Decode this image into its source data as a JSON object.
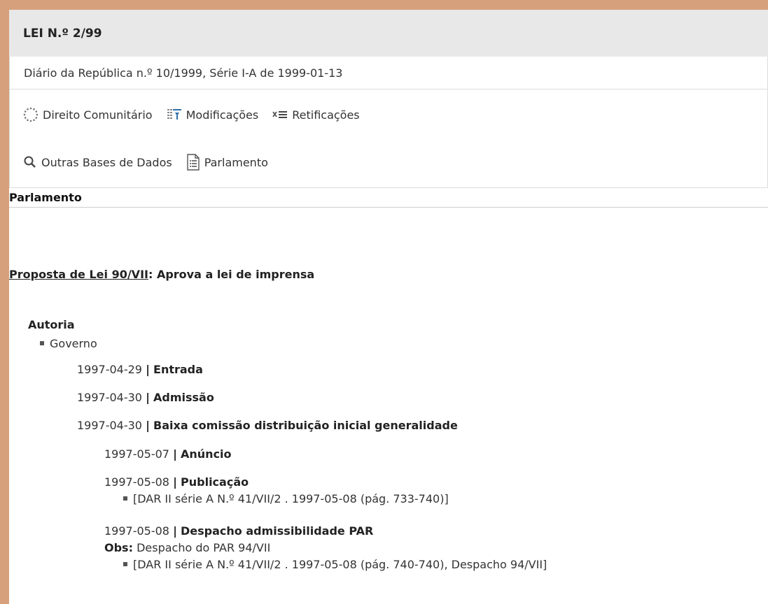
{
  "header": {
    "title": "LEI N.º 2/99"
  },
  "subinfo": {
    "text": "Diário da República n.º 10/1999, Série I-A de 1999-01-13"
  },
  "toolbar": {
    "direito": "Direito Comunitário",
    "modificacoes": "Modificações",
    "retificacoes": "Retificações",
    "outras": "Outras Bases de Dados",
    "parlamento": "Parlamento"
  },
  "section": {
    "title": "Parlamento"
  },
  "proposta": {
    "link": "Proposta de Lei 90/VII",
    "rest": ": Aprova a lei de imprensa"
  },
  "autoria": {
    "label": "Autoria",
    "item": "Governo"
  },
  "events": [
    {
      "date": "1997-04-29",
      "label": "Entrada"
    },
    {
      "date": "1997-04-30",
      "label": "Admissão"
    },
    {
      "date": "1997-04-30",
      "label": "Baixa comissão distribuição inicial generalidade"
    },
    {
      "date": "1997-05-07",
      "label": "Anúncio"
    },
    {
      "date": "1997-05-08",
      "label": "Publicação",
      "ref": "[DAR II série A N.º 41/VII/2 . 1997-05-08 (pág. 733-740)]"
    },
    {
      "date": "1997-05-08",
      "label": "Despacho admissibilidade PAR",
      "obs_label": "Obs:",
      "obs": "Despacho do PAR 94/VII",
      "ref": "[DAR II série A N.º 41/VII/2 . 1997-05-08 (pág. 740-740), Despacho 94/VII]"
    }
  ],
  "separator": "|"
}
